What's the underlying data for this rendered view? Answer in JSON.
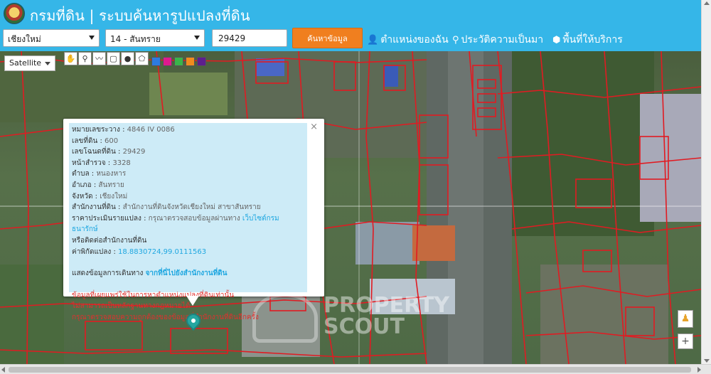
{
  "header": {
    "title": "กรมที่ดิน | ระบบค้นหารูปแปลงที่ดิน",
    "province_select": "เชียงใหม่",
    "district_select": "14 - สันทราย",
    "parcel_input": "29429",
    "search_button": "ค้นหาข้อมูล",
    "nav": {
      "my_location": "ตำแหน่งของฉัน",
      "history": "ประวัติความเป็นมา",
      "service_area": "พื้นที่ให้บริการ"
    },
    "bg_color": "#35b6e8",
    "button_color": "#f07f1f"
  },
  "map": {
    "map_type": "Satellite",
    "tools": [
      "hand-icon",
      "marker-icon",
      "polyline-icon",
      "rectangle-icon",
      "circle-icon",
      "polygon-icon"
    ],
    "swatch_colors": [
      "#2d7be0",
      "#e0198f",
      "#39b54a",
      "#f08c1e",
      "#5e1e8f"
    ],
    "parcel_line_color": "#e11b22"
  },
  "info": {
    "rows": [
      {
        "label": "หมายเลขระวาง",
        "value": "4846 IV 0086"
      },
      {
        "label": "เลขที่ดิน",
        "value": "600"
      },
      {
        "label": "เลขโฉนดที่ดิน",
        "value": "29429"
      },
      {
        "label": "หน้าสำรวจ",
        "value": "3328"
      },
      {
        "label": "ตำบล",
        "value": "หนองหาร"
      },
      {
        "label": "อำเภอ",
        "value": "สันทราย"
      },
      {
        "label": "จังหวัด",
        "value": "เชียงใหม่"
      },
      {
        "label": "สำนักงานที่ดิน",
        "value": "สำนักงานที่ดินจังหวัดเชียงใหม่ สาขาสันทราย"
      }
    ],
    "price_label": "ราคาประเมินรายแปลง",
    "price_text": "กรุณาตรวจสอบข้อมูลผ่านทาง",
    "price_link": "เว็บไซต์กรมธนารักษ์",
    "price_contact": "หรือติดต่อสำนักงานที่ดิน",
    "coord_label": "ค่าพิกัดแปลง",
    "coord_value": "18.8830724,99.0111563",
    "route_text": "แสดงข้อมูลการเดินทาง",
    "route_link": "จากที่นี่ไปยังสำนักงานที่ดิน",
    "disclaimer_1": "ข้อมูลที่เผยแพร่ใช้ในการหาตำแหน่งแปลงที่ดินเท่านั้น",
    "disclaimer_2": "ไม่สามารถเป็นหลักฐานทางกฎหมายได้",
    "disclaimer_3": "กรุณาตรวจสอบความถูกต้องของข้อมูลที่สำนักงานที่ดินอีกครั้ง",
    "close": "×"
  },
  "watermark": {
    "line1": "PROPERTY",
    "line2": "SCOUT"
  }
}
